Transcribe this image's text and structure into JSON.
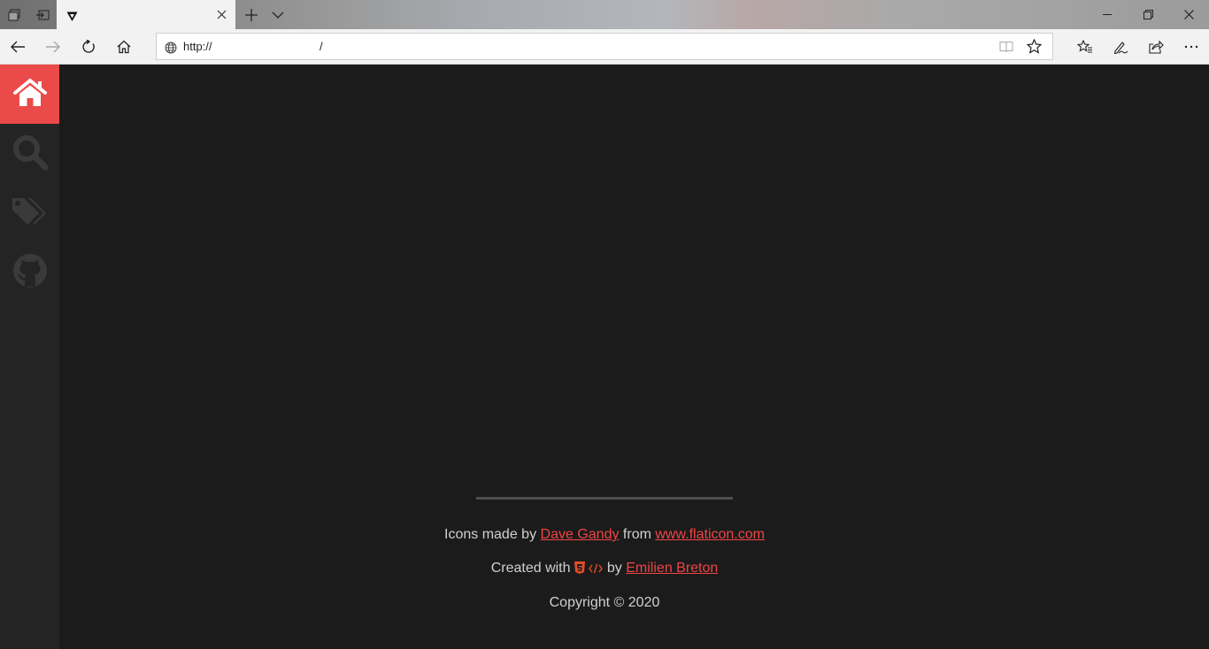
{
  "browser": {
    "address_scheme": "http://",
    "address_path": "/",
    "icons": {
      "tab_preview": "tab-preview-icon",
      "set_aside": "set-aside-tabs-icon",
      "favicon": "site-favicon-icon",
      "tab_close": "close-icon",
      "new_tab": "plus-icon",
      "tab_list": "chevron-down-icon",
      "minimize": "minimize-icon",
      "restore": "restore-icon",
      "window_close": "close-icon",
      "back": "arrow-left-icon",
      "forward": "arrow-right-icon",
      "refresh": "refresh-icon",
      "home": "home-icon",
      "globe": "globe-icon",
      "reading_view": "book-icon",
      "favorite": "star-icon",
      "favorites_list": "favorites-icon",
      "notes": "pen-icon",
      "share": "share-icon",
      "more": "more-icon"
    }
  },
  "sidebar": {
    "items": [
      {
        "icon": "home-icon",
        "active": true
      },
      {
        "icon": "search-icon",
        "active": false
      },
      {
        "icon": "tags-icon",
        "active": false
      },
      {
        "icon": "github-icon",
        "active": false
      }
    ]
  },
  "footer": {
    "icons_prefix": "Icons made by",
    "icons_author": "Dave Gandy",
    "icons_from": "from",
    "icons_site": "www.flaticon.com",
    "created_prefix": "Created with",
    "created_by": "by",
    "created_author": "Emilien Breton",
    "copyright": "Copyright © 2020"
  },
  "colors": {
    "accent": "#ea4a49",
    "link": "#f04444",
    "page_bg": "#1b1b1b",
    "sidebar_bg": "#242424",
    "footer_text": "#d0d0d0"
  }
}
